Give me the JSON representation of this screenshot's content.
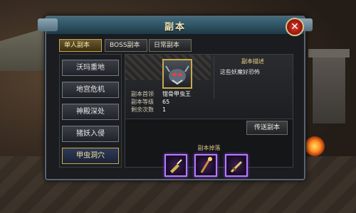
{
  "window": {
    "title": "副本"
  },
  "tabs": [
    {
      "label": "单人副本",
      "active": true
    },
    {
      "label": "BOSS副本",
      "active": false
    },
    {
      "label": "日常副本",
      "active": false
    }
  ],
  "dungeons": [
    {
      "label": "沃玛重地",
      "active": false
    },
    {
      "label": "地宫危机",
      "active": false
    },
    {
      "label": "神殿深处",
      "active": false
    },
    {
      "label": "猪妖入侵",
      "active": false
    },
    {
      "label": "甲虫洞穴",
      "active": true
    }
  ],
  "details": {
    "boss_label": "副本首领",
    "boss_name": "钳骨甲虫王",
    "level_label": "副本等级",
    "level_value": "65",
    "remaining_label": "剩余次数",
    "remaining_value": "1",
    "desc_title": "副本描述",
    "desc_text": "这些妖魔好恐怖"
  },
  "teleport_button": "传送副本",
  "drops_title": "副本掉落",
  "drops": [
    {
      "icon": "dagger-icon",
      "rarity_color": "#b67bff"
    },
    {
      "icon": "staff-icon",
      "rarity_color": "#b67bff"
    },
    {
      "icon": "sword-icon",
      "rarity_color": "#b67bff"
    }
  ],
  "colors": {
    "accent_gold": "#c9a94b",
    "title_bar": "#3f6b7d",
    "close_red": "#e23a2a"
  }
}
